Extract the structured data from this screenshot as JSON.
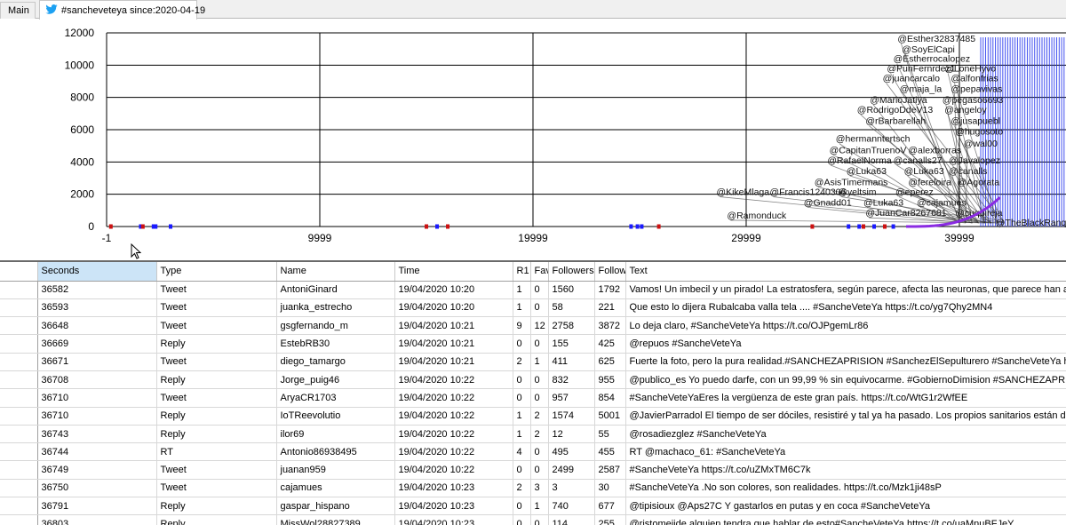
{
  "tabs": [
    {
      "label": "Main"
    },
    {
      "label": "#sancheveteya since:2020-04-19",
      "icon": "twitter-icon"
    }
  ],
  "colors": {
    "accent": "#1da1f2",
    "selected_header": "#cce4f7",
    "point_blue": "#1a1aff",
    "point_red": "#cc1111",
    "point_purple": "#8a2be2"
  },
  "chart_data": {
    "type": "scatter",
    "xlim": [
      -1,
      45000
    ],
    "ylim": [
      0,
      12000
    ],
    "x_ticks": [
      "-1",
      "9999",
      "19999",
      "29999",
      "39999"
    ],
    "x_tick_values": [
      -1,
      9999,
      19999,
      29999,
      39999
    ],
    "y_ticks": [
      "0",
      "2000",
      "4000",
      "6000",
      "8000",
      "10000",
      "12000"
    ],
    "y_tick_values": [
      0,
      2000,
      4000,
      6000,
      8000,
      10000,
      12000
    ],
    "grid": true,
    "series": [
      {
        "color": "blue",
        "points": [
          {
            "x": 1600,
            "y": 0
          },
          {
            "x": 2200,
            "y": 0
          },
          {
            "x": 2300,
            "y": 0
          },
          {
            "x": 3000,
            "y": 0
          },
          {
            "x": 15500,
            "y": 0
          },
          {
            "x": 24600,
            "y": 0
          },
          {
            "x": 24900,
            "y": 0
          },
          {
            "x": 25100,
            "y": 0
          },
          {
            "x": 34800,
            "y": 0
          },
          {
            "x": 35300,
            "y": 0
          },
          {
            "x": 36000,
            "y": 0
          },
          {
            "x": 36900,
            "y": 0
          }
        ]
      },
      {
        "color": "red",
        "points": [
          {
            "x": 200,
            "y": 0
          },
          {
            "x": 1700,
            "y": 0
          },
          {
            "x": 15000,
            "y": 0
          },
          {
            "x": 16000,
            "y": 0
          },
          {
            "x": 25900,
            "y": 0
          },
          {
            "x": 33100,
            "y": 0
          },
          {
            "x": 35500,
            "y": 0
          },
          {
            "x": 36500,
            "y": 0
          }
        ]
      }
    ],
    "labels": [
      {
        "text": "@Esther32837485",
        "x": 37100,
        "y": 11450
      },
      {
        "text": "@SoyElCapi",
        "x": 37300,
        "y": 10800
      },
      {
        "text": "@Estherrocalopez",
        "x": 36900,
        "y": 10200
      },
      {
        "text": "@PuriFernrdez1",
        "x": 36600,
        "y": 9600
      },
      {
        "text": "@LoneHyvo",
        "x": 39300,
        "y": 9600
      },
      {
        "text": "@juancarcalo",
        "x": 36400,
        "y": 9000
      },
      {
        "text": "@alfonfrias",
        "x": 39600,
        "y": 9000
      },
      {
        "text": "@maja_la",
        "x": 37200,
        "y": 8350
      },
      {
        "text": "@pepavivas",
        "x": 39600,
        "y": 8350
      },
      {
        "text": "@MarioJatiya",
        "x": 35800,
        "y": 7650
      },
      {
        "text": "@pegaso6693",
        "x": 39200,
        "y": 7650
      },
      {
        "text": "@RodrigoDdeV13",
        "x": 35200,
        "y": 7050
      },
      {
        "text": "@angeloy",
        "x": 39300,
        "y": 7050
      },
      {
        "text": "@rBarbarellah",
        "x": 35600,
        "y": 6350
      },
      {
        "text": "@jusapuebl",
        "x": 39600,
        "y": 6350
      },
      {
        "text": "@hugosoto",
        "x": 39800,
        "y": 5700
      },
      {
        "text": "@hermanntertsch",
        "x": 34200,
        "y": 5250
      },
      {
        "text": "@wal00",
        "x": 40200,
        "y": 4950
      },
      {
        "text": "@CapitanTruenoV",
        "x": 33900,
        "y": 4550
      },
      {
        "text": "@alexborras",
        "x": 37600,
        "y": 4550
      },
      {
        "text": "@RafaelNorma",
        "x": 33800,
        "y": 3900
      },
      {
        "text": "@canalls27",
        "x": 36900,
        "y": 3900
      },
      {
        "text": "@Javalopez",
        "x": 39500,
        "y": 3900
      },
      {
        "text": "@Luka63",
        "x": 34700,
        "y": 3250
      },
      {
        "text": "@Luka63",
        "x": 37400,
        "y": 3250
      },
      {
        "text": "@canalls",
        "x": 39500,
        "y": 3250
      },
      {
        "text": "@AsisTimermans",
        "x": 33200,
        "y": 2550
      },
      {
        "text": "@fereloira",
        "x": 37600,
        "y": 2550
      },
      {
        "text": "@Agorata",
        "x": 39900,
        "y": 2550
      },
      {
        "text": "@KikeMlaga",
        "x": 28600,
        "y": 1950
      },
      {
        "text": "@Francis1240306",
        "x": 31100,
        "y": 1950
      },
      {
        "text": "@yeltsim",
        "x": 34300,
        "y": 1950
      },
      {
        "text": "@eperez",
        "x": 37000,
        "y": 1950
      },
      {
        "text": "@Gnadd01",
        "x": 32700,
        "y": 1300
      },
      {
        "text": "@Luka63",
        "x": 35500,
        "y": 1300
      },
      {
        "text": "@cajamues",
        "x": 38000,
        "y": 1300
      },
      {
        "text": "@JuanCar8267681",
        "x": 35600,
        "y": 650
      },
      {
        "text": "@cuquireja",
        "x": 39800,
        "y": 650
      },
      {
        "text": "@Ramonduck",
        "x": 29100,
        "y": 500
      },
      {
        "text": "@TheBlackRanqueDelBarco",
        "x": 41700,
        "y": 50
      }
    ]
  },
  "table": {
    "columns": [
      "Seconds",
      "Type",
      "Name",
      "Time",
      "R1",
      "Favs",
      "Followers",
      "Followi",
      "Text"
    ],
    "rows": [
      [
        "36582",
        "Tweet",
        "AntoniGinard",
        "19/04/2020 10:20",
        "1",
        "0",
        "1560",
        "1792",
        "Vamos! Un imbecil y un pirado! La estratosfera, según parece, afecta las neuronas, que parece han afectado a..."
      ],
      [
        "36593",
        "Tweet",
        "juanka_estrecho",
        "19/04/2020 10:20",
        "1",
        "0",
        "58",
        "221",
        "Que esto lo dijera Rubalcaba valla tela .... #SancheVeteYa https://t.co/yg7Qhy2MN4"
      ],
      [
        "36648",
        "Tweet",
        "gsgfernando_m",
        "19/04/2020 10:21",
        "9",
        "12",
        "2758",
        "3872",
        "Lo deja claro, #SancheVeteYa https://t.co/OJPgemLr86"
      ],
      [
        "36669",
        "Reply",
        "EstebRB30",
        "19/04/2020 10:21",
        "0",
        "0",
        "155",
        "425",
        "@repuos #SancheVeteYa"
      ],
      [
        "36671",
        "Tweet",
        "diego_tamargo",
        "19/04/2020 10:21",
        "2",
        "1",
        "411",
        "625",
        "Fuerte la foto, pero la pura realidad.#SANCHEZAPRISION #SanchezElSepulturero #SancheVeteYa https://t.co"
      ],
      [
        "36708",
        "Reply",
        "Jorge_puig46",
        "19/04/2020 10:22",
        "0",
        "0",
        "832",
        "955",
        "@publico_es Yo puedo darfe, con un 99,99 % sin equivocarme. #GobiernoDimision #SANCHEZAPRISION #Sa"
      ],
      [
        "36710",
        "Tweet",
        "AryaCR1703",
        "19/04/2020 10:22",
        "0",
        "0",
        "957",
        "854",
        "#SancheVeteYaEres la vergüenza de este gran país. https://t.co/WtG1r2WfEE"
      ],
      [
        "36710",
        "Reply",
        "IoTReevolutio",
        "19/04/2020 10:22",
        "1",
        "2",
        "1574",
        "5001",
        "@JavierParradol El tiempo de ser dóciles, resistiré y tal ya ha pasado. Los propios sanitarios están diciendo que d"
      ],
      [
        "36743",
        "Reply",
        "ilor69",
        "19/04/2020 10:22",
        "1",
        "2",
        "12",
        "55",
        "@rosadiezglez #SancheVeteYa"
      ],
      [
        "36744",
        "RT",
        "Antonio86938495",
        "19/04/2020 10:22",
        "4",
        "0",
        "495",
        "455",
        "RT @machaco_61: #SancheVeteYa"
      ],
      [
        "36749",
        "Tweet",
        "juanan959",
        "19/04/2020 10:22",
        "0",
        "0",
        "2499",
        "2587",
        "#SancheVeteYa https://t.co/uZMxTM6C7k"
      ],
      [
        "36750",
        "Tweet",
        "cajamues",
        "19/04/2020 10:23",
        "2",
        "3",
        "3",
        "30",
        "#SancheVeteYa .No son colores, son realidades. https://t.co/Mzk1ji48sP"
      ],
      [
        "36791",
        "Reply",
        "gaspar_hispano",
        "19/04/2020 10:23",
        "0",
        "1",
        "740",
        "677",
        "@tipisioux @Aps27C Y gastarlos en putas y en coca #SancheVeteYa"
      ],
      [
        "36803",
        "Reply",
        "MissWol28827389",
        "19/04/2020 10:23",
        "0",
        "0",
        "114",
        "255",
        "@ristomejide alguien tendra que hablar de esto#SancheVeteYa https://t.co/uaMnuBFJeY"
      ]
    ]
  }
}
